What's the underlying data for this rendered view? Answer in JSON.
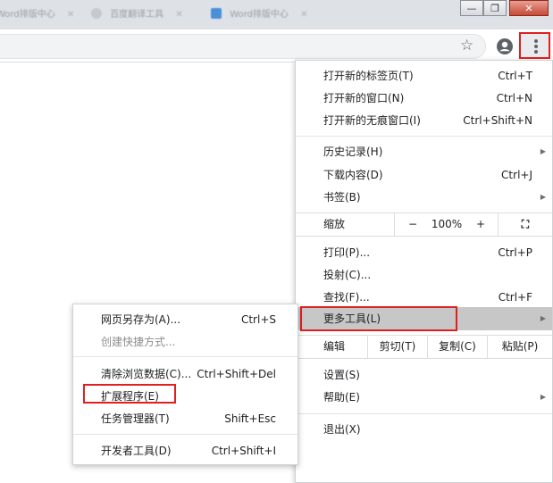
{
  "titlebar": {
    "tabs": [
      {
        "title": "Word排版中心"
      },
      {
        "title": "百度翻译工具"
      },
      {
        "title": "Word排版中心"
      }
    ],
    "controls": {
      "minimize": "—",
      "restore": "❐",
      "close": "✕"
    }
  },
  "toolbar": {
    "star_glyph": "☆"
  },
  "menu": {
    "group1": [
      {
        "label": "打开新的标签页(T)",
        "shortcut": "Ctrl+T"
      },
      {
        "label": "打开新的窗口(N)",
        "shortcut": "Ctrl+N"
      },
      {
        "label": "打开新的无痕窗口(I)",
        "shortcut": "Ctrl+Shift+N"
      }
    ],
    "group2": [
      {
        "label": "历史记录(H)",
        "arrow": "▶"
      },
      {
        "label": "下载内容(D)",
        "shortcut": "Ctrl+J"
      },
      {
        "label": "书签(B)",
        "arrow": "▶"
      }
    ],
    "zoom": {
      "label": "缩放",
      "minus": "−",
      "value": "100%",
      "plus": "+",
      "fullscreen": "⛶"
    },
    "group3": [
      {
        "label": "打印(P)...",
        "shortcut": "Ctrl+P"
      },
      {
        "label": "投射(C)..."
      },
      {
        "label": "查找(F)...",
        "shortcut": "Ctrl+F"
      },
      {
        "label": "更多工具(L)",
        "arrow": "▶"
      }
    ],
    "edit": {
      "label": "编辑",
      "cut": "剪切(T)",
      "copy": "复制(C)",
      "paste": "粘贴(P)"
    },
    "group4": [
      {
        "label": "设置(S)"
      },
      {
        "label": "帮助(E)",
        "arrow": "▶"
      }
    ],
    "exit": {
      "label": "退出(X)"
    }
  },
  "submenu": {
    "items": [
      {
        "label": "网页另存为(A)...",
        "shortcut": "Ctrl+S"
      },
      {
        "label": "创建快捷方式..."
      },
      {
        "label": "清除浏览数据(C)...",
        "shortcut": "Ctrl+Shift+Del"
      },
      {
        "label": "扩展程序(E)"
      },
      {
        "label": "任务管理器(T)",
        "shortcut": "Shift+Esc"
      },
      {
        "label": "开发者工具(D)",
        "shortcut": "Ctrl+Shift+I"
      }
    ]
  },
  "colors": {
    "highlight_box": "#e02020",
    "hover_bg": "#c7c7c7",
    "tabstrip": "#dee1e6"
  }
}
